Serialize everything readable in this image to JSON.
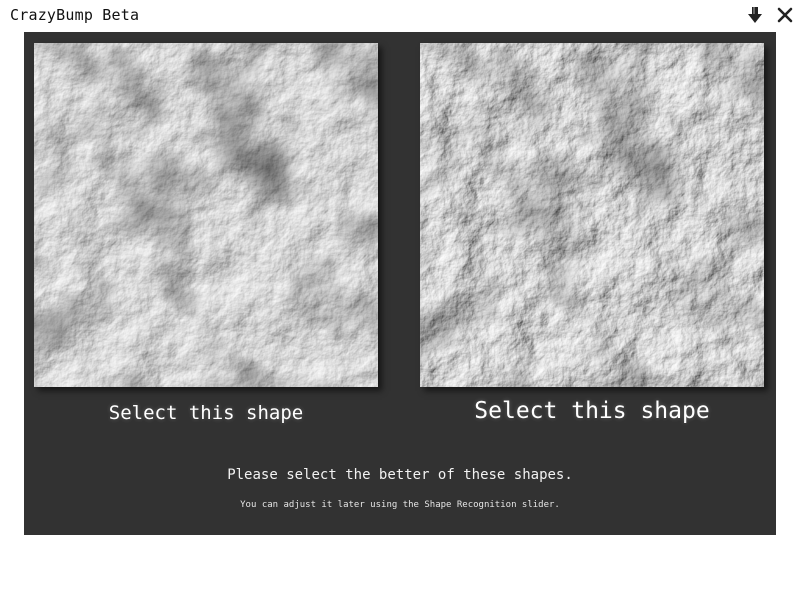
{
  "window": {
    "title": "CrazyBump Beta",
    "minimize_icon": "down-arrow-icon",
    "close_icon": "close-x-icon"
  },
  "shapes": [
    {
      "label": "Select this shape"
    },
    {
      "label": "Select this shape"
    }
  ],
  "instruction": "Please select the better of these shapes.",
  "hint": "You can adjust it later using the Shape Recognition slider.",
  "colors": {
    "panel_bg": "#323232",
    "text": "#ffffff"
  }
}
